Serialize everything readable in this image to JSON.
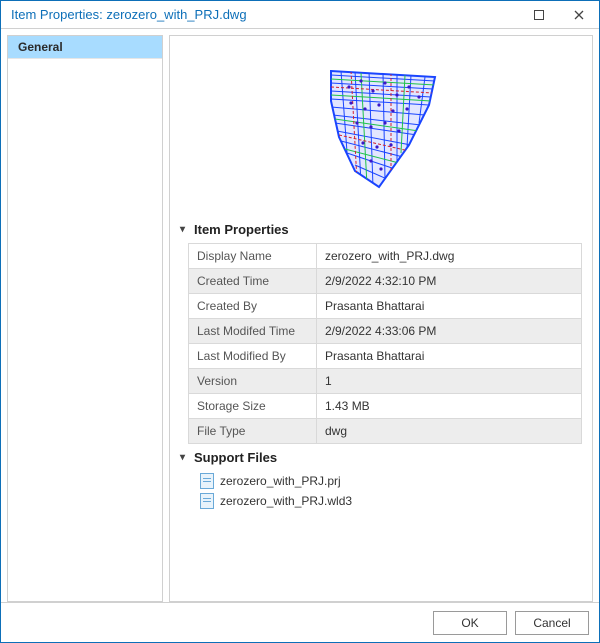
{
  "window": {
    "title_prefix": "Item Properties: ",
    "title_item": "zerozero_with_PRJ.dwg"
  },
  "sidebar": {
    "items": [
      {
        "label": "General"
      }
    ]
  },
  "sections": {
    "item_properties_label": "Item Properties",
    "support_files_label": "Support Files"
  },
  "properties": [
    {
      "label": "Display Name",
      "value": "zerozero_with_PRJ.dwg"
    },
    {
      "label": "Created Time",
      "value": "2/9/2022 4:32:10 PM"
    },
    {
      "label": "Created By",
      "value": "Prasanta Bhattarai"
    },
    {
      "label": "Last Modifed Time",
      "value": "2/9/2022 4:33:06 PM"
    },
    {
      "label": "Last Modified By",
      "value": "Prasanta Bhattarai"
    },
    {
      "label": "Version",
      "value": "1"
    },
    {
      "label": "Storage Size",
      "value": "1.43 MB"
    },
    {
      "label": "File Type",
      "value": "dwg"
    }
  ],
  "support_files": [
    {
      "name": "zerozero_with_PRJ.prj"
    },
    {
      "name": "zerozero_with_PRJ.wld3"
    }
  ],
  "buttons": {
    "ok": "OK",
    "cancel": "Cancel"
  }
}
